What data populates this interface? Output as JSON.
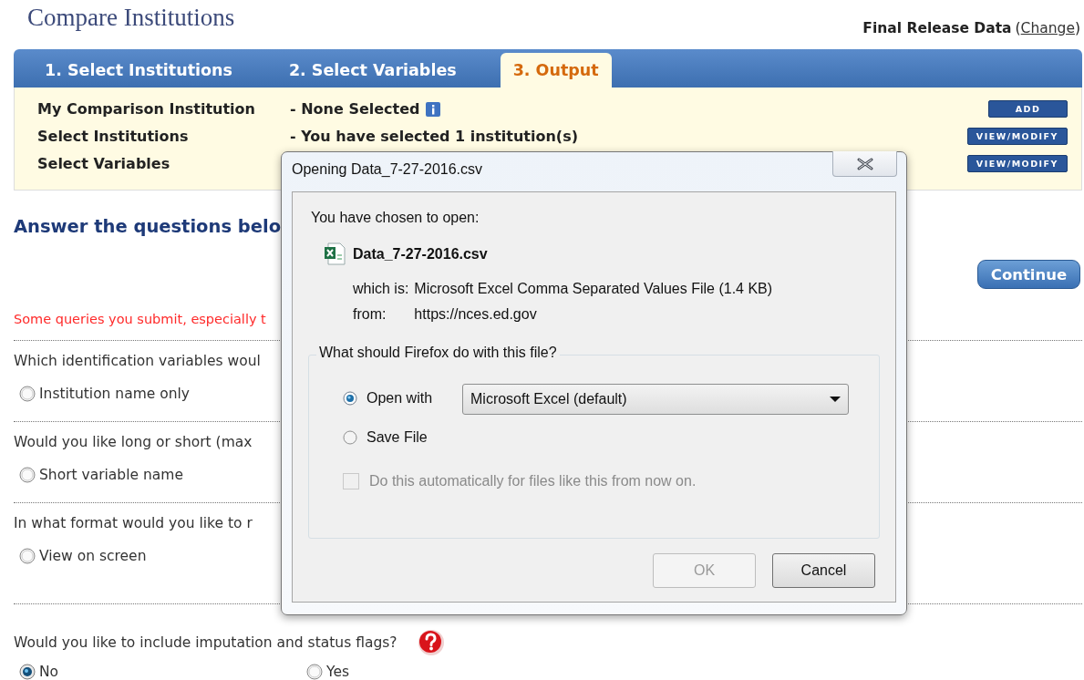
{
  "page_title": "Compare Institutions",
  "release": {
    "label": "Final Release Data",
    "open_paren": "(",
    "link": "Change",
    "close_paren": ")"
  },
  "tabs": [
    {
      "label": "1. Select Institutions",
      "selected": false
    },
    {
      "label": "2. Select Variables",
      "selected": false
    },
    {
      "label": "3. Output",
      "selected": true
    }
  ],
  "summary": [
    {
      "label": "My Comparison Institution",
      "value": "- None Selected",
      "info": true,
      "button": "ADD"
    },
    {
      "label": "Select Institutions",
      "value": "- You have selected 1 institution(s)",
      "info": false,
      "button": "VIEW/MODIFY"
    },
    {
      "label": "Select Variables",
      "button": "VIEW/MODIFY"
    }
  ],
  "heading": "Answer the questions belo",
  "continue_button": "Continue",
  "warning": "Some queries you submit, especially t",
  "questions": [
    {
      "text": "Which identification variables woul",
      "help": false,
      "options": [
        {
          "label": "Institution name only",
          "selected": false
        }
      ]
    },
    {
      "text": "Would you like long or short (max",
      "help": false,
      "options": [
        {
          "label": "Short variable name",
          "selected": false
        }
      ]
    },
    {
      "text": "In what format would you like to r",
      "help": false,
      "options": [
        {
          "label": "View on screen",
          "selected": false
        }
      ]
    },
    {
      "text": "Would you like to include imputation and status flags?",
      "help": true,
      "options": [
        {
          "label": "No",
          "selected": true
        },
        {
          "label": "Yes",
          "selected": false
        }
      ]
    }
  ],
  "dialog": {
    "title": "Opening Data_7-27-2016.csv",
    "intro": "You have chosen to open:",
    "file_name": "Data_7-27-2016.csv",
    "type_label": "which is:",
    "type_value": "Microsoft Excel Comma Separated Values File (1.4 KB)",
    "from_label": "from:",
    "from_value": "https://nces.ed.gov",
    "group_label": "What should Firefox do with this file?",
    "actions": [
      {
        "label": "Open with",
        "selected": true,
        "kind": "select",
        "app": "Microsoft Excel (default)"
      },
      {
        "label": "Save File",
        "selected": false,
        "kind": "plain"
      }
    ],
    "remember": {
      "label": "Do this automatically for files like this from now on.",
      "checked": false,
      "disabled": true
    },
    "buttons": [
      {
        "label": "OK",
        "disabled": true
      },
      {
        "label": "Cancel",
        "disabled": false
      }
    ]
  }
}
